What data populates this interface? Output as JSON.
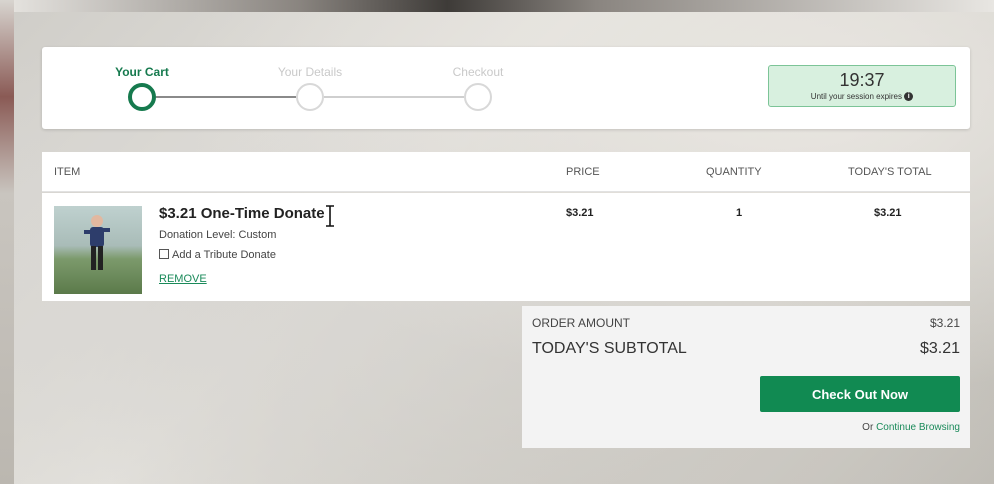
{
  "progress": {
    "steps": [
      {
        "label": "Your Cart",
        "active": true
      },
      {
        "label": "Your Details",
        "active": false
      },
      {
        "label": "Checkout",
        "active": false
      }
    ]
  },
  "timer": {
    "value": "19:37",
    "note": "Until your session expires"
  },
  "table": {
    "headers": {
      "item": "ITEM",
      "price": "PRICE",
      "quantity": "QUANTITY",
      "total": "TODAY'S TOTAL"
    },
    "row": {
      "title": "$3.21 One-Time Donate",
      "level": "Donation Level: Custom",
      "tribute": "Add a Tribute Donate",
      "tribute_checked": false,
      "remove": "REMOVE",
      "price": "$3.21",
      "quantity": "1",
      "total": "$3.21"
    }
  },
  "summary": {
    "order_amount_label": "ORDER AMOUNT",
    "order_amount_value": "$3.21",
    "subtotal_label": "TODAY'S SUBTOTAL",
    "subtotal_value": "$3.21",
    "checkout_button": "Check Out Now",
    "continue_prefix": "Or",
    "continue_link": "Continue Browsing"
  },
  "colors": {
    "brand_green": "#118a52",
    "timer_bg": "#d8f0df",
    "link_green": "#1a8a5a"
  }
}
